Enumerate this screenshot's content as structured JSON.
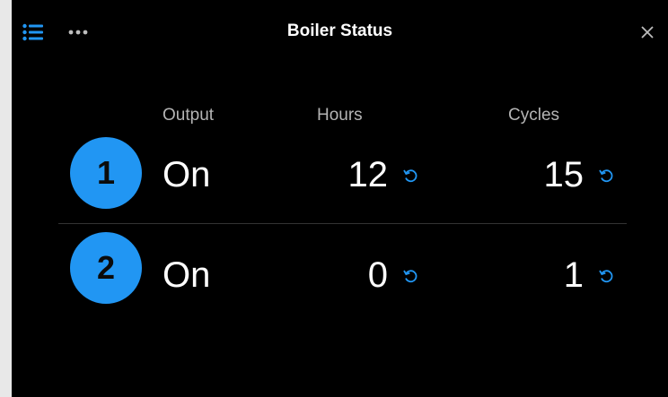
{
  "window": {
    "title": "Boiler Status"
  },
  "icons": {
    "menu": "list-icon",
    "more": "more-horizontal-icon",
    "close": "close-icon",
    "reset": "reset-icon"
  },
  "colors": {
    "accent": "#2196f3",
    "background": "#000000",
    "text": "#ffffff",
    "muted": "#b4b4b4"
  },
  "columns": {
    "output": "Output",
    "hours": "Hours",
    "cycles": "Cycles"
  },
  "boilers": [
    {
      "number": "1",
      "output": "On",
      "hours": "12",
      "cycles": "15"
    },
    {
      "number": "2",
      "output": "On",
      "hours": "0",
      "cycles": "1"
    }
  ]
}
